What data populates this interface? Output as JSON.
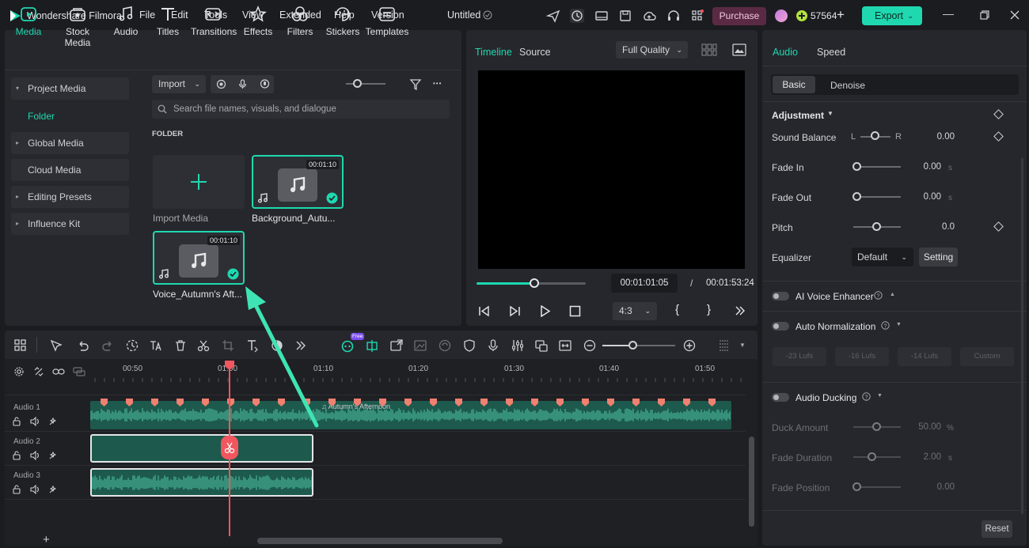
{
  "app": {
    "title": "Wondershare Filmora",
    "project_name": "Untitled",
    "credits": "57564",
    "purchase_label": "Purchase",
    "export_label": "Export"
  },
  "menu": [
    "File",
    "Edit",
    "Tools",
    "View",
    "Extended",
    "Help",
    "Version"
  ],
  "tools": [
    "Media",
    "Stock Media",
    "Audio",
    "Titles",
    "Transitions",
    "Effects",
    "Filters",
    "Stickers",
    "Templates"
  ],
  "sidebar": {
    "items": [
      {
        "label": "Project Media",
        "caret": "▾"
      },
      {
        "label": "Folder"
      },
      {
        "label": "Global Media",
        "caret": "▸"
      },
      {
        "label": "Cloud Media"
      },
      {
        "label": "Editing Presets",
        "caret": "▸"
      },
      {
        "label": "Influence Kit",
        "caret": "▸"
      }
    ]
  },
  "media": {
    "import_label": "Import",
    "search_placeholder": "Search file names, visuals, and dialogue",
    "folder_heading": "FOLDER",
    "import_media_label": "Import Media",
    "clips": [
      {
        "name": "Background_Autu...",
        "duration": "00:01:10"
      },
      {
        "name": "Voice_Autumn's Aft...",
        "duration": "00:01:10"
      }
    ]
  },
  "preview": {
    "tabs": [
      "Timeline",
      "Source"
    ],
    "quality": "Full Quality",
    "current_time": "00:01:01:05",
    "separator": "/",
    "total_time": "00:01:53:24",
    "aspect": "4:3",
    "progress": 0.53
  },
  "inspector": {
    "tabs": [
      "Audio",
      "Speed"
    ],
    "subtabs": [
      "Basic",
      "Denoise"
    ],
    "adjustment_heading": "Adjustment",
    "sound_balance": {
      "label": "Sound Balance",
      "left": "L",
      "right": "R",
      "value": "0.00"
    },
    "fade_in": {
      "label": "Fade In",
      "value": "0.00",
      "unit": "s"
    },
    "fade_out": {
      "label": "Fade Out",
      "value": "0.00",
      "unit": "s"
    },
    "pitch": {
      "label": "Pitch",
      "value": "0.0"
    },
    "equalizer": {
      "label": "Equalizer",
      "preset": "Default",
      "setting_label": "Setting"
    },
    "ai_voice_enhancer": "AI Voice Enhancer",
    "auto_normalization": "Auto Normalization",
    "lufs": [
      "-23 Lufs",
      "-16 Lufs",
      "-14 Lufs",
      "Custom"
    ],
    "audio_ducking": "Audio Ducking",
    "duck_amount": {
      "label": "Duck Amount",
      "value": "50.00",
      "unit": "%"
    },
    "fade_duration": {
      "label": "Fade Duration",
      "value": "2.00",
      "unit": "s"
    },
    "fade_position": {
      "label": "Fade Position",
      "value": "0.00"
    },
    "reset_label": "Reset"
  },
  "timeline": {
    "free_badge": "Free",
    "ruler": [
      "00:50",
      "01:00",
      "01:10",
      "01:20",
      "01:30",
      "01:40",
      "01:50"
    ],
    "tracks": [
      "Audio 1",
      "Audio 2",
      "Audio 3"
    ],
    "clip_label": "Autumn's Afternoon"
  },
  "colors": {
    "accent": "#1fd8b0",
    "purchase": "#c94a8a",
    "playhead": "#f2565e",
    "waveform": "#3d9e85"
  }
}
